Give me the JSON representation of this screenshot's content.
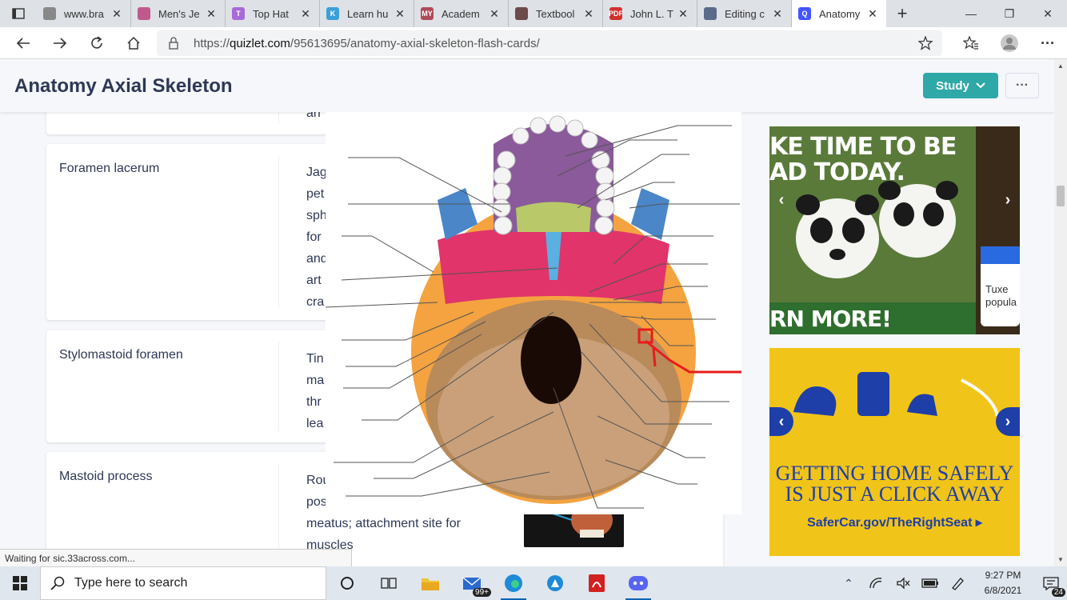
{
  "tabs": [
    {
      "title": "www.bra",
      "color": "#888"
    },
    {
      "title": "Men's Je",
      "color": "#c05a8c"
    },
    {
      "title": "Top Hat",
      "color": "#a86ad8"
    },
    {
      "title": "Learn hu",
      "color": "#3b9fd8"
    },
    {
      "title": "Academ",
      "color": "#b04a5a"
    },
    {
      "title": "Textbool",
      "color": "#6a4a4a"
    },
    {
      "title": "John L. T",
      "color": "#d32f2f"
    },
    {
      "title": "Editing c",
      "color": "#5a6a8a"
    },
    {
      "title": "Anatomy",
      "color": "#4255ff"
    }
  ],
  "address": {
    "prefix": "https://",
    "domain": "quizlet.com",
    "path": "/95613695/anatomy-axial-skeleton-flash-cards/"
  },
  "page": {
    "title": "Anatomy Axial Skeleton",
    "study_label": "Study",
    "more_label": "···"
  },
  "terms": [
    {
      "word": "",
      "definition": "an"
    },
    {
      "word": "Foramen lacerum",
      "definition": "Jag pet sph for and art cra"
    },
    {
      "word": "Stylomastoid foramen",
      "definition": "Tin ma thr lea"
    },
    {
      "word": "Mastoid process",
      "definition": "Rou pos meatus; attachment site for muscles"
    }
  ],
  "term_defs_lines": {
    "first": [
      "an"
    ],
    "lacerum": [
      "Jag",
      "pet",
      "sph",
      "for",
      "and",
      "art",
      "cra"
    ],
    "stylo": [
      "Tin",
      "ma",
      "thr",
      "lea"
    ],
    "mastoid": [
      "Rou",
      "pos",
      "meatus; attachment site for",
      "muscles"
    ]
  },
  "ads": {
    "panda_top": "KE TIME TO BE",
    "panda_mid": "AD TODAY.",
    "panda_bottom": "RN MORE!",
    "panda_side": "Tuxe popula",
    "car_line1": "GETTING HOME SAFELY",
    "car_line2": "IS JUST A CLICK AWAY",
    "car_url": "SaferCar.gov/TheRightSeat ▸"
  },
  "status_text": "Waiting for sic.33across.com...",
  "taskbar": {
    "search_placeholder": "Type here to search",
    "mail_badge": "99+",
    "time": "9:27 PM",
    "date": "6/8/2021",
    "notif_count": "24"
  }
}
